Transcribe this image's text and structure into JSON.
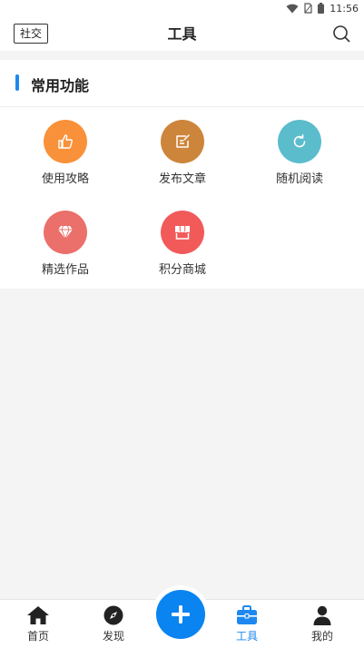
{
  "status_bar": {
    "time": "11:56",
    "icons": [
      "wifi-icon",
      "no-sim-icon",
      "battery-icon"
    ]
  },
  "header": {
    "tag_label": "社交",
    "title": "工具",
    "search_icon": "search-icon"
  },
  "section": {
    "title": "常用功能",
    "accent_color": "#1e88f0",
    "items": [
      {
        "label": "使用攻略",
        "icon": "thumbs-up-icon",
        "color": "#f9913a"
      },
      {
        "label": "发布文章",
        "icon": "edit-icon",
        "color": "#cc853a"
      },
      {
        "label": "随机阅读",
        "icon": "refresh-icon",
        "color": "#5bbccc"
      },
      {
        "label": "精选作品",
        "icon": "diamond-icon",
        "color": "#eb6f6a"
      },
      {
        "label": "积分商城",
        "icon": "store-icon",
        "color": "#f25a5a"
      }
    ]
  },
  "tabbar": {
    "active_color": "#1e88f0",
    "tabs": [
      {
        "label": "首页",
        "icon": "home-icon"
      },
      {
        "label": "发现",
        "icon": "compass-icon"
      },
      {
        "label": "工具",
        "icon": "toolbox-icon",
        "active": true
      },
      {
        "label": "我的",
        "icon": "user-icon"
      }
    ],
    "fab_icon": "plus-icon",
    "fab_color": "#0a84f0"
  }
}
